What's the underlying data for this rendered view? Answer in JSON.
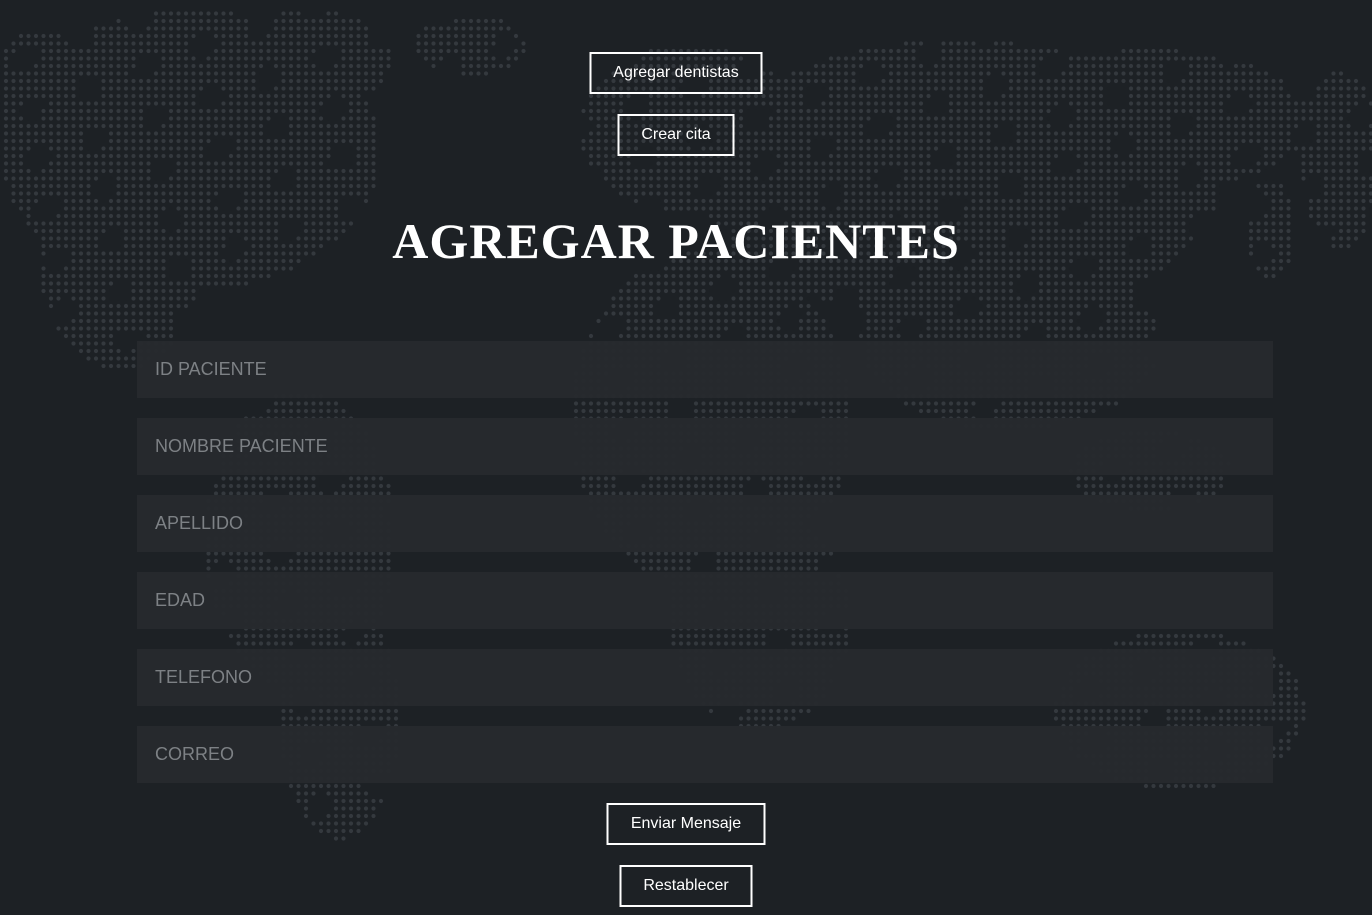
{
  "nav": {
    "add_dentists_label": "Agregar dentistas",
    "create_appointment_label": "Crear cita"
  },
  "page": {
    "title": "AGREGAR PACIENTES"
  },
  "form": {
    "fields": [
      {
        "placeholder": "ID PACIENTE",
        "value": ""
      },
      {
        "placeholder": "NOMBRE PACIENTE",
        "value": ""
      },
      {
        "placeholder": "APELLIDO",
        "value": ""
      },
      {
        "placeholder": "EDAD",
        "value": ""
      },
      {
        "placeholder": "TELEFONO",
        "value": ""
      },
      {
        "placeholder": "CORREO",
        "value": ""
      }
    ],
    "submit_label": "Enviar Mensaje",
    "reset_label": "Restablecer"
  },
  "colors": {
    "background": "#1d2125",
    "field_background": "#262a2e",
    "map_dots": "#34393e",
    "text": "#ffffff",
    "placeholder": "#7d8185"
  }
}
